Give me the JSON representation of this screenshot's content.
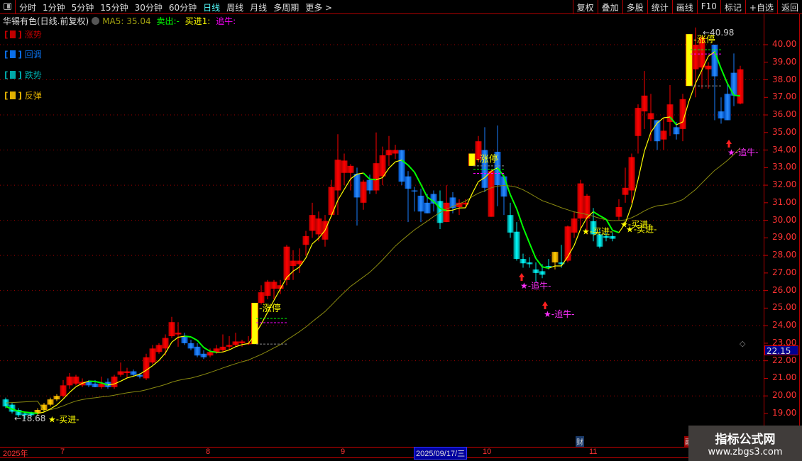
{
  "toolbar": {
    "periods": [
      "分时",
      "1分钟",
      "5分钟",
      "15分钟",
      "30分钟",
      "60分钟",
      "日线",
      "周线",
      "月线",
      "多周期",
      "更多 >"
    ],
    "active_period": "日线",
    "right_buttons": [
      "复权",
      "叠加",
      "多股",
      "统计",
      "画线",
      "F10",
      "标记",
      "+自选",
      "返回"
    ]
  },
  "info": {
    "title": "华锡有色(日线.前复权)",
    "ma5": "MA5: 35.04",
    "sell": "卖出:-",
    "buy": "买进1:",
    "chase": "追牛:"
  },
  "legend": [
    {
      "label": "涨势",
      "color": "#c00000"
    },
    {
      "label": "回调",
      "color": "#0a6fe8"
    },
    {
      "label": "跌势",
      "color": "#00a8a8"
    },
    {
      "label": "反弹",
      "color": "#e0b000"
    }
  ],
  "current_price": "22.15",
  "xaxis": {
    "labels": [
      "2025年",
      "7",
      "8",
      "9",
      "10",
      "11"
    ],
    "cursor_date": "2025/09/17/三"
  },
  "markers": {
    "finance": "财",
    "event": "融"
  },
  "watermark": {
    "title": "指标公式网",
    "url": "www.zbgs3.com"
  },
  "chart_data": {
    "type": "candlestick",
    "ylim": [
      18.5,
      41
    ],
    "yticks": [
      "40.00",
      "39.00",
      "38.00",
      "37.00",
      "36.00",
      "35.00",
      "34.00",
      "33.00",
      "32.00",
      "31.00",
      "30.00",
      "29.00",
      "28.00",
      "27.00",
      "26.00",
      "25.00",
      "24.00",
      "23.00",
      "22.00",
      "21.00",
      "20.00",
      "19.00"
    ],
    "colors": {
      "up": "#ff0000",
      "down": "#1a7fff",
      "cyan": "#00e0e0",
      "limit": "#ffff00",
      "gold": "#ffb800",
      "ma5": "#ffff00",
      "ma5_down": "#00ff00",
      "ma_long": "#8a8a10"
    },
    "candles": [
      [
        19.8,
        19.9,
        19.3,
        19.4,
        "cy"
      ],
      [
        19.5,
        19.6,
        19.0,
        19.1,
        "cy"
      ],
      [
        19.2,
        19.3,
        18.8,
        18.9,
        "cy"
      ],
      [
        19.0,
        19.1,
        18.68,
        18.9,
        "cy"
      ],
      [
        19.0,
        19.1,
        18.8,
        18.9,
        "cy"
      ],
      [
        19.0,
        19.3,
        18.9,
        19.2,
        "gd"
      ],
      [
        19.2,
        19.6,
        19.1,
        19.5,
        "gd"
      ],
      [
        19.5,
        19.9,
        19.4,
        19.8,
        "gd"
      ],
      [
        19.8,
        20.1,
        19.7,
        20.0,
        "gd"
      ],
      [
        20.0,
        20.9,
        19.9,
        20.6,
        "up"
      ],
      [
        20.6,
        21.3,
        20.4,
        21.1,
        "up"
      ],
      [
        20.7,
        21.2,
        20.6,
        21.1,
        "up"
      ],
      [
        20.6,
        21.0,
        20.5,
        20.8,
        "up"
      ],
      [
        20.8,
        20.9,
        20.5,
        20.6,
        "dn"
      ],
      [
        20.7,
        20.9,
        20.5,
        20.5,
        "dn"
      ],
      [
        20.5,
        21.1,
        20.4,
        20.7,
        "up"
      ],
      [
        20.8,
        21.0,
        20.4,
        20.5,
        "dn"
      ],
      [
        20.5,
        21.2,
        20.4,
        21.1,
        "up"
      ],
      [
        21.2,
        21.9,
        21.1,
        21.4,
        "up"
      ],
      [
        21.3,
        21.6,
        21.0,
        21.4,
        "up"
      ],
      [
        21.4,
        21.5,
        21.1,
        21.2,
        "dn"
      ],
      [
        21.2,
        21.3,
        21.0,
        21.1,
        "dn"
      ],
      [
        21.0,
        22.4,
        20.9,
        22.2,
        "up"
      ],
      [
        21.9,
        22.9,
        21.8,
        22.7,
        "up"
      ],
      [
        22.5,
        23.0,
        22.4,
        22.9,
        "up"
      ],
      [
        22.7,
        23.5,
        22.3,
        23.3,
        "up"
      ],
      [
        23.4,
        24.5,
        23.3,
        24.2,
        "up"
      ],
      [
        23.5,
        24.2,
        22.8,
        23.6,
        "up"
      ],
      [
        23.4,
        23.6,
        22.9,
        23.0,
        "dn"
      ],
      [
        23.0,
        23.2,
        22.6,
        22.7,
        "dn"
      ],
      [
        22.8,
        23.0,
        22.2,
        22.3,
        "dn"
      ],
      [
        22.4,
        22.6,
        22.1,
        22.2,
        "dn"
      ],
      [
        22.3,
        22.7,
        22.2,
        22.5,
        "up"
      ],
      [
        22.5,
        22.9,
        22.4,
        22.7,
        "up"
      ],
      [
        22.6,
        23.5,
        22.5,
        22.8,
        "up"
      ],
      [
        22.8,
        23.4,
        22.6,
        22.9,
        "up"
      ],
      [
        22.9,
        23.6,
        22.8,
        23.1,
        "up"
      ],
      [
        23.0,
        23.2,
        22.8,
        23.1,
        "up"
      ],
      [
        23.0,
        23.4,
        22.9,
        23.0,
        "up"
      ],
      [
        22.95,
        25.3,
        22.95,
        25.3,
        "lim"
      ],
      [
        25.3,
        26.3,
        25.2,
        25.9,
        "up"
      ],
      [
        25.7,
        26.6,
        25.5,
        26.5,
        "up"
      ],
      [
        26.1,
        26.6,
        25.5,
        26.5,
        "up"
      ],
      [
        26.1,
        26.6,
        25.8,
        26.3,
        "up"
      ],
      [
        26.6,
        28.6,
        26.3,
        28.5,
        "up"
      ],
      [
        27.4,
        28.3,
        26.6,
        27.7,
        "up"
      ],
      [
        27.5,
        28.4,
        27.0,
        27.7,
        "up"
      ],
      [
        28.6,
        29.4,
        28.0,
        29.1,
        "up"
      ],
      [
        29.4,
        31.0,
        29.0,
        30.3,
        "up"
      ],
      [
        29.2,
        30.5,
        28.8,
        30.1,
        "up"
      ],
      [
        28.9,
        30.3,
        28.5,
        29.95,
        "up"
      ],
      [
        30.3,
        32.3,
        30.2,
        31.9,
        "up"
      ],
      [
        31.7,
        34.9,
        30.3,
        33.45,
        "up"
      ],
      [
        32.7,
        33.8,
        32.0,
        33.4,
        "up"
      ],
      [
        32.7,
        33.2,
        31.7,
        33.1,
        "up"
      ],
      [
        32.65,
        33.0,
        29.7,
        31.3,
        "dn"
      ],
      [
        31.0,
        32.3,
        30.6,
        32.2,
        "up"
      ],
      [
        32.3,
        32.6,
        31.5,
        31.7,
        "dn"
      ],
      [
        31.7,
        35.0,
        31.5,
        33.25,
        "up"
      ],
      [
        32.5,
        34.2,
        32.0,
        33.7,
        "up"
      ],
      [
        33.7,
        34.8,
        33.1,
        34.0,
        "up"
      ],
      [
        33.8,
        34.3,
        33.5,
        34.0,
        "up"
      ],
      [
        34.0,
        34.0,
        32.0,
        32.2,
        "dn"
      ],
      [
        32.5,
        32.8,
        29.9,
        31.8,
        "dn"
      ],
      [
        31.7,
        31.9,
        30.5,
        31.7,
        "dn"
      ],
      [
        31.4,
        31.8,
        29.9,
        30.5,
        "dn"
      ],
      [
        31.0,
        31.5,
        30.4,
        30.4,
        "dn"
      ],
      [
        31.5,
        31.7,
        30.5,
        30.95,
        "dn"
      ],
      [
        31.1,
        31.7,
        29.5,
        29.85,
        "cy"
      ],
      [
        29.9,
        32.0,
        29.9,
        31.0,
        "up"
      ],
      [
        31.3,
        31.6,
        30.4,
        30.7,
        "dn"
      ],
      [
        30.75,
        31.2,
        30.3,
        31.0,
        "up"
      ],
      [
        30.9,
        31.2,
        30.7,
        31.0,
        "up"
      ],
      [
        33.1,
        33.8,
        33.1,
        33.8,
        "lim"
      ],
      [
        33.45,
        34.8,
        33.3,
        34.5,
        "up"
      ],
      [
        34.0,
        35.3,
        31.6,
        31.85,
        "dn"
      ],
      [
        30.2,
        32.9,
        30.2,
        32.8,
        "up"
      ],
      [
        33.9,
        35.4,
        30.8,
        32.0,
        "dn"
      ],
      [
        32.5,
        32.6,
        30.3,
        31.35,
        "dn"
      ],
      [
        30.3,
        31.0,
        29.0,
        29.3,
        "cy"
      ],
      [
        29.35,
        29.9,
        27.7,
        27.8,
        "cy"
      ],
      [
        27.8,
        28.1,
        27.3,
        27.55,
        "cy"
      ],
      [
        27.6,
        27.9,
        27.3,
        27.5,
        "cy"
      ],
      [
        27.2,
        27.6,
        26.5,
        27.0,
        "cy"
      ],
      [
        27.1,
        27.5,
        26.7,
        26.9,
        "cy"
      ],
      [
        27.4,
        27.8,
        27.2,
        27.4,
        "cy"
      ],
      [
        27.6,
        28.2,
        27.2,
        28.2,
        "gd"
      ],
      [
        27.6,
        28.6,
        27.3,
        27.5,
        "cy"
      ],
      [
        27.7,
        29.7,
        27.6,
        29.65,
        "up"
      ],
      [
        29.3,
        30.5,
        29.0,
        30.1,
        "up"
      ],
      [
        30.1,
        32.3,
        29.5,
        32.1,
        "up"
      ],
      [
        30.1,
        31.5,
        29.2,
        31.4,
        "up"
      ],
      [
        29.95,
        30.7,
        28.8,
        29.2,
        "cy"
      ],
      [
        29.2,
        29.5,
        28.4,
        28.5,
        "cy"
      ],
      [
        29.0,
        29.3,
        28.8,
        29.1,
        "cy"
      ],
      [
        29.1,
        29.3,
        28.8,
        28.95,
        "cy"
      ],
      [
        30.2,
        31.2,
        30.0,
        30.75,
        "up"
      ],
      [
        31.45,
        33.0,
        31.0,
        31.85,
        "up"
      ],
      [
        31.7,
        33.8,
        31.0,
        33.6,
        "up"
      ],
      [
        34.8,
        36.6,
        33.8,
        36.4,
        "up"
      ],
      [
        36.2,
        38.5,
        35.2,
        37.1,
        "up"
      ],
      [
        35.75,
        37.2,
        34.5,
        36.1,
        "up"
      ],
      [
        35.7,
        35.7,
        34.0,
        34.5,
        "dn"
      ],
      [
        34.6,
        35.8,
        34.0,
        35.1,
        "up"
      ],
      [
        35.6,
        37.7,
        34.8,
        36.6,
        "up"
      ],
      [
        35.3,
        35.6,
        34.6,
        34.9,
        "dn"
      ],
      [
        35.2,
        37.2,
        34.5,
        36.9,
        "up"
      ],
      [
        37.65,
        40.6,
        37.65,
        40.6,
        "lim"
      ],
      [
        38.6,
        40.98,
        37.0,
        40.0,
        "up"
      ],
      [
        38.7,
        40.5,
        37.5,
        40.4,
        "up"
      ],
      [
        38.6,
        39.0,
        37.5,
        38.8,
        "up"
      ],
      [
        40.0,
        40.0,
        35.7,
        38.2,
        "dn"
      ],
      [
        36.2,
        37.0,
        35.5,
        35.8,
        "dn"
      ],
      [
        37.2,
        37.8,
        35.8,
        35.7,
        "dn"
      ],
      [
        38.4,
        39.5,
        36.5,
        37.1,
        "dn"
      ],
      [
        36.65,
        38.8,
        36.6,
        38.6,
        "up"
      ]
    ],
    "annotations": {
      "limit_up": {
        "label": "涨停",
        "indices": [
          39,
          73,
          107
        ]
      },
      "buy": {
        "label": "买进",
        "indices": [
          5,
          91,
          96
        ]
      },
      "chase": {
        "label": "追牛",
        "indices": [
          81,
          84,
          113
        ]
      },
      "low_label": "18.68",
      "high_label": "40.98"
    }
  }
}
